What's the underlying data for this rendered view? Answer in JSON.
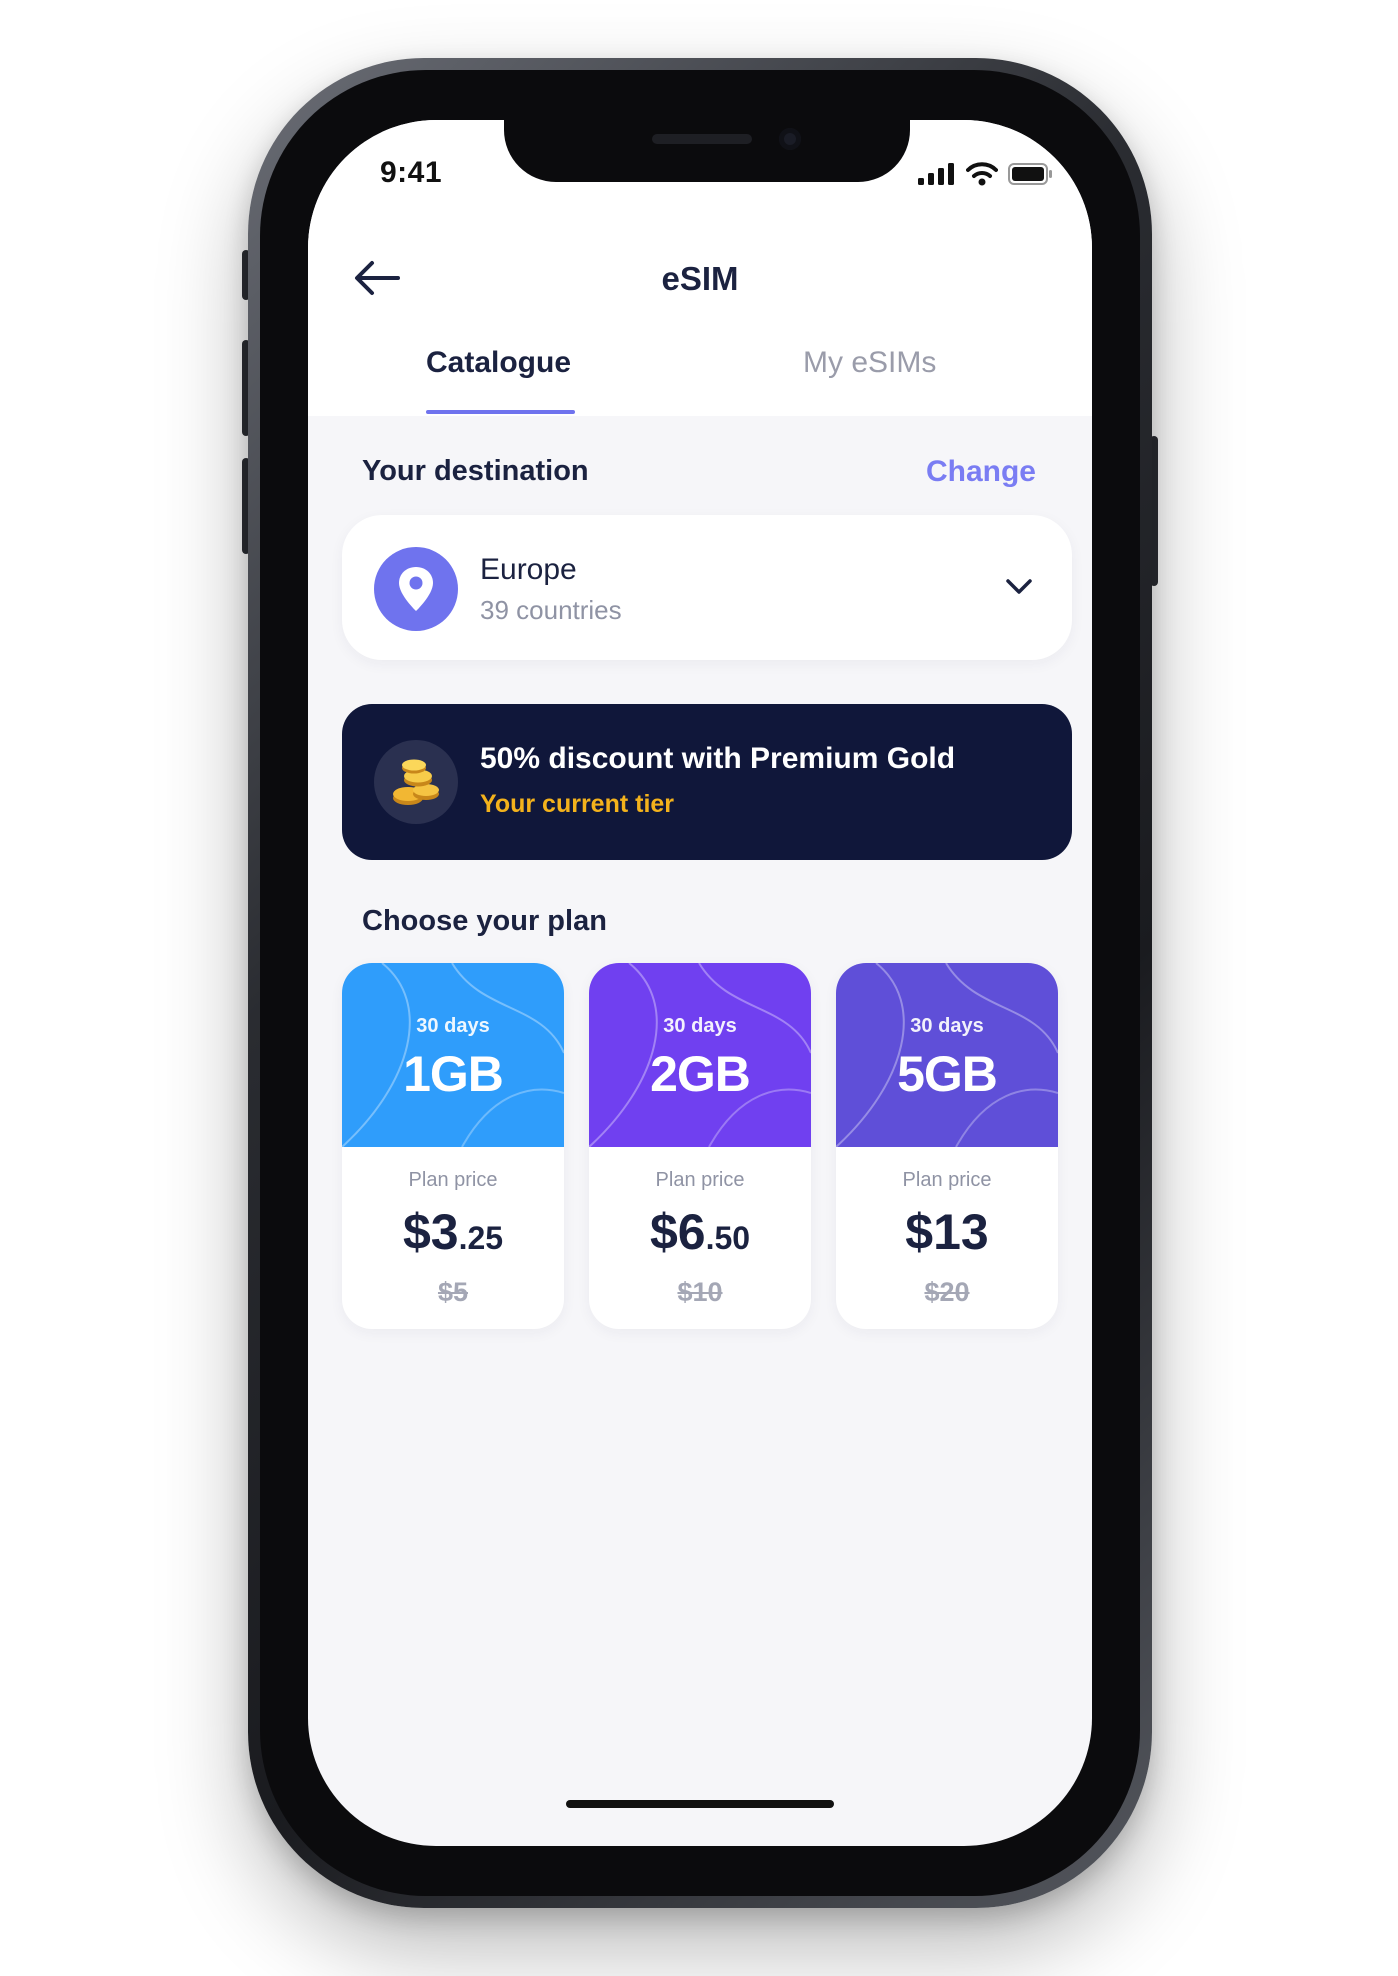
{
  "status_bar": {
    "time": "9:41"
  },
  "header": {
    "title": "eSIM"
  },
  "tabs": [
    {
      "label": "Catalogue",
      "active": true
    },
    {
      "label": "My eSIMs",
      "active": false
    }
  ],
  "destination": {
    "section_label": "Your destination",
    "change_label": "Change",
    "name": "Europe",
    "countries": "39 countries"
  },
  "banner": {
    "title": "50% discount with Premium Gold",
    "subtitle": "Your current tier"
  },
  "plans": {
    "section_label": "Choose your plan",
    "items": [
      {
        "duration": "30 days",
        "size": "1GB",
        "price_label": "Plan price",
        "price_main": "$3",
        "price_cents": ".25",
        "old_price": "$5",
        "color": "#2f9dfb"
      },
      {
        "duration": "30 days",
        "size": "2GB",
        "price_label": "Plan price",
        "price_main": "$6",
        "price_cents": ".50",
        "old_price": "$10",
        "color": "#7040f0"
      },
      {
        "duration": "30 days",
        "size": "5GB",
        "price_label": "Plan price",
        "price_main": "$13",
        "price_cents": "",
        "old_price": "$20",
        "color": "#5f4fd8"
      }
    ]
  },
  "colors": {
    "accent": "#6f73ee",
    "banner_bg": "#10173a",
    "tier_gold": "#f3b21c"
  }
}
